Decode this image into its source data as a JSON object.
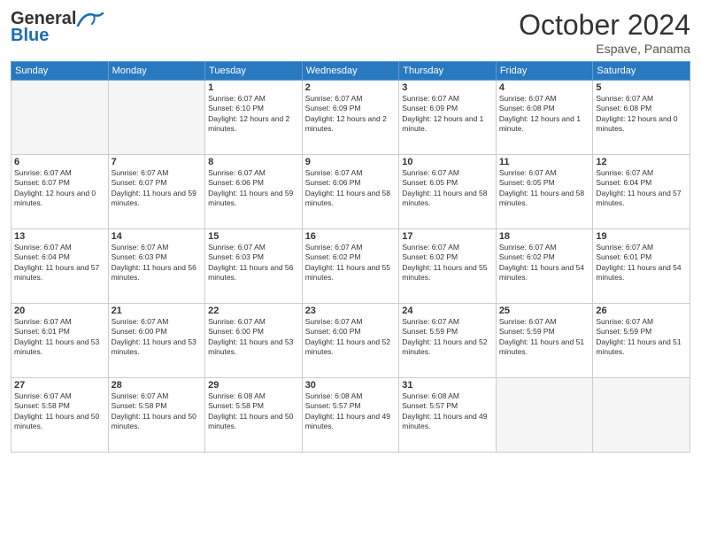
{
  "header": {
    "logo_general": "General",
    "logo_blue": "Blue",
    "month": "October 2024",
    "location": "Espave, Panama"
  },
  "days_header": [
    "Sunday",
    "Monday",
    "Tuesday",
    "Wednesday",
    "Thursday",
    "Friday",
    "Saturday"
  ],
  "weeks": [
    [
      {
        "day": "",
        "empty": true
      },
      {
        "day": "",
        "empty": true
      },
      {
        "day": "1",
        "sunrise": "Sunrise: 6:07 AM",
        "sunset": "Sunset: 6:10 PM",
        "daylight": "Daylight: 12 hours and 2 minutes."
      },
      {
        "day": "2",
        "sunrise": "Sunrise: 6:07 AM",
        "sunset": "Sunset: 6:09 PM",
        "daylight": "Daylight: 12 hours and 2 minutes."
      },
      {
        "day": "3",
        "sunrise": "Sunrise: 6:07 AM",
        "sunset": "Sunset: 6:09 PM",
        "daylight": "Daylight: 12 hours and 1 minute."
      },
      {
        "day": "4",
        "sunrise": "Sunrise: 6:07 AM",
        "sunset": "Sunset: 6:08 PM",
        "daylight": "Daylight: 12 hours and 1 minute."
      },
      {
        "day": "5",
        "sunrise": "Sunrise: 6:07 AM",
        "sunset": "Sunset: 6:08 PM",
        "daylight": "Daylight: 12 hours and 0 minutes."
      }
    ],
    [
      {
        "day": "6",
        "sunrise": "Sunrise: 6:07 AM",
        "sunset": "Sunset: 6:07 PM",
        "daylight": "Daylight: 12 hours and 0 minutes."
      },
      {
        "day": "7",
        "sunrise": "Sunrise: 6:07 AM",
        "sunset": "Sunset: 6:07 PM",
        "daylight": "Daylight: 11 hours and 59 minutes."
      },
      {
        "day": "8",
        "sunrise": "Sunrise: 6:07 AM",
        "sunset": "Sunset: 6:06 PM",
        "daylight": "Daylight: 11 hours and 59 minutes."
      },
      {
        "day": "9",
        "sunrise": "Sunrise: 6:07 AM",
        "sunset": "Sunset: 6:06 PM",
        "daylight": "Daylight: 11 hours and 58 minutes."
      },
      {
        "day": "10",
        "sunrise": "Sunrise: 6:07 AM",
        "sunset": "Sunset: 6:05 PM",
        "daylight": "Daylight: 11 hours and 58 minutes."
      },
      {
        "day": "11",
        "sunrise": "Sunrise: 6:07 AM",
        "sunset": "Sunset: 6:05 PM",
        "daylight": "Daylight: 11 hours and 58 minutes."
      },
      {
        "day": "12",
        "sunrise": "Sunrise: 6:07 AM",
        "sunset": "Sunset: 6:04 PM",
        "daylight": "Daylight: 11 hours and 57 minutes."
      }
    ],
    [
      {
        "day": "13",
        "sunrise": "Sunrise: 6:07 AM",
        "sunset": "Sunset: 6:04 PM",
        "daylight": "Daylight: 11 hours and 57 minutes."
      },
      {
        "day": "14",
        "sunrise": "Sunrise: 6:07 AM",
        "sunset": "Sunset: 6:03 PM",
        "daylight": "Daylight: 11 hours and 56 minutes."
      },
      {
        "day": "15",
        "sunrise": "Sunrise: 6:07 AM",
        "sunset": "Sunset: 6:03 PM",
        "daylight": "Daylight: 11 hours and 56 minutes."
      },
      {
        "day": "16",
        "sunrise": "Sunrise: 6:07 AM",
        "sunset": "Sunset: 6:02 PM",
        "daylight": "Daylight: 11 hours and 55 minutes."
      },
      {
        "day": "17",
        "sunrise": "Sunrise: 6:07 AM",
        "sunset": "Sunset: 6:02 PM",
        "daylight": "Daylight: 11 hours and 55 minutes."
      },
      {
        "day": "18",
        "sunrise": "Sunrise: 6:07 AM",
        "sunset": "Sunset: 6:02 PM",
        "daylight": "Daylight: 11 hours and 54 minutes."
      },
      {
        "day": "19",
        "sunrise": "Sunrise: 6:07 AM",
        "sunset": "Sunset: 6:01 PM",
        "daylight": "Daylight: 11 hours and 54 minutes."
      }
    ],
    [
      {
        "day": "20",
        "sunrise": "Sunrise: 6:07 AM",
        "sunset": "Sunset: 6:01 PM",
        "daylight": "Daylight: 11 hours and 53 minutes."
      },
      {
        "day": "21",
        "sunrise": "Sunrise: 6:07 AM",
        "sunset": "Sunset: 6:00 PM",
        "daylight": "Daylight: 11 hours and 53 minutes."
      },
      {
        "day": "22",
        "sunrise": "Sunrise: 6:07 AM",
        "sunset": "Sunset: 6:00 PM",
        "daylight": "Daylight: 11 hours and 53 minutes."
      },
      {
        "day": "23",
        "sunrise": "Sunrise: 6:07 AM",
        "sunset": "Sunset: 6:00 PM",
        "daylight": "Daylight: 11 hours and 52 minutes."
      },
      {
        "day": "24",
        "sunrise": "Sunrise: 6:07 AM",
        "sunset": "Sunset: 5:59 PM",
        "daylight": "Daylight: 11 hours and 52 minutes."
      },
      {
        "day": "25",
        "sunrise": "Sunrise: 6:07 AM",
        "sunset": "Sunset: 5:59 PM",
        "daylight": "Daylight: 11 hours and 51 minutes."
      },
      {
        "day": "26",
        "sunrise": "Sunrise: 6:07 AM",
        "sunset": "Sunset: 5:59 PM",
        "daylight": "Daylight: 11 hours and 51 minutes."
      }
    ],
    [
      {
        "day": "27",
        "sunrise": "Sunrise: 6:07 AM",
        "sunset": "Sunset: 5:58 PM",
        "daylight": "Daylight: 11 hours and 50 minutes."
      },
      {
        "day": "28",
        "sunrise": "Sunrise: 6:07 AM",
        "sunset": "Sunset: 5:58 PM",
        "daylight": "Daylight: 11 hours and 50 minutes."
      },
      {
        "day": "29",
        "sunrise": "Sunrise: 6:08 AM",
        "sunset": "Sunset: 5:58 PM",
        "daylight": "Daylight: 11 hours and 50 minutes."
      },
      {
        "day": "30",
        "sunrise": "Sunrise: 6:08 AM",
        "sunset": "Sunset: 5:57 PM",
        "daylight": "Daylight: 11 hours and 49 minutes."
      },
      {
        "day": "31",
        "sunrise": "Sunrise: 6:08 AM",
        "sunset": "Sunset: 5:57 PM",
        "daylight": "Daylight: 11 hours and 49 minutes."
      },
      {
        "day": "",
        "empty": true
      },
      {
        "day": "",
        "empty": true
      }
    ]
  ]
}
